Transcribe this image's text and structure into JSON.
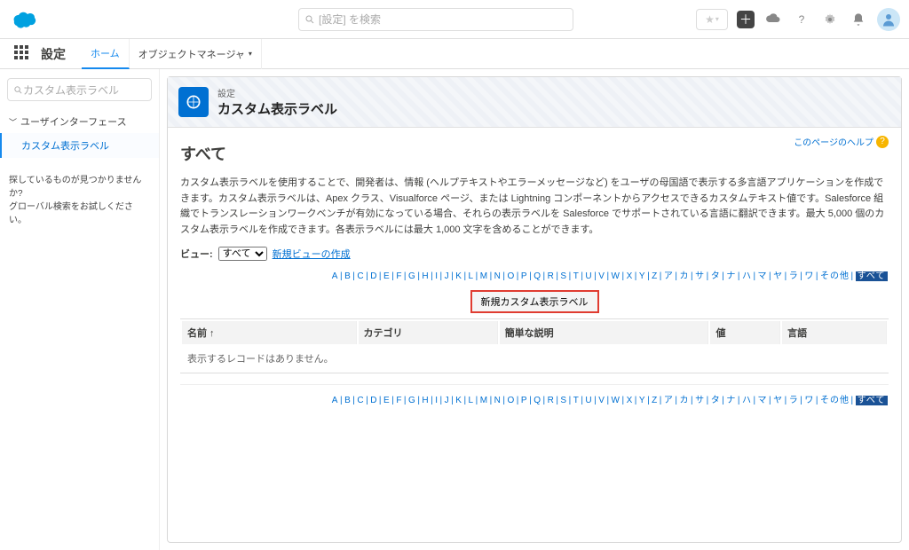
{
  "topbar": {
    "search_placeholder": "[設定] を検索"
  },
  "nav": {
    "title": "設定",
    "tab_home": "ホーム",
    "tab_object_manager": "オブジェクトマネージャ"
  },
  "sidebar": {
    "search_placeholder": "カスタム表示ラベル",
    "tree_root": "ユーザインターフェース",
    "tree_item": "カスタム表示ラベル",
    "hint_line1": "探しているものが見つかりませんか?",
    "hint_line2": "グローバル検索をお試しください。"
  },
  "header": {
    "breadcrumb": "設定",
    "title": "カスタム表示ラベル"
  },
  "body": {
    "help_link": "このページのヘルプ",
    "section_title": "すべて",
    "description": "カスタム表示ラベルを使用することで、開発者は、情報 (ヘルプテキストやエラーメッセージなど) をユーザの母国語で表示する多言語アプリケーションを作成できます。カスタム表示ラベルは、Apex クラス、Visualforce ページ、または Lightning コンポーネントからアクセスできるカスタムテキスト値です。Salesforce 組織でトランスレーションワークベンチが有効になっている場合、それらの表示ラベルを Salesforce でサポートされている言語に翻訳できます。最大 5,000 個のカスタム表示ラベルを作成できます。各表示ラベルには最大 1,000 文字を含めることができます。",
    "view_label": "ビュー:",
    "view_option": "すべて",
    "view_new_link": "新規ビューの作成",
    "new_button": "新規カスタム表示ラベル",
    "table": {
      "col_name": "名前 ↑",
      "col_category": "カテゴリ",
      "col_desc": "簡単な説明",
      "col_value": "値",
      "col_lang": "言語",
      "empty": "表示するレコードはありません。"
    },
    "alpha": [
      "A",
      "B",
      "C",
      "D",
      "E",
      "F",
      "G",
      "H",
      "I",
      "J",
      "K",
      "L",
      "M",
      "N",
      "O",
      "P",
      "Q",
      "R",
      "S",
      "T",
      "U",
      "V",
      "W",
      "X",
      "Y",
      "Z",
      "ア",
      "カ",
      "サ",
      "タ",
      "ナ",
      "ハ",
      "マ",
      "ヤ",
      "ラ",
      "ワ",
      "その他"
    ],
    "alpha_all": "すべて"
  }
}
